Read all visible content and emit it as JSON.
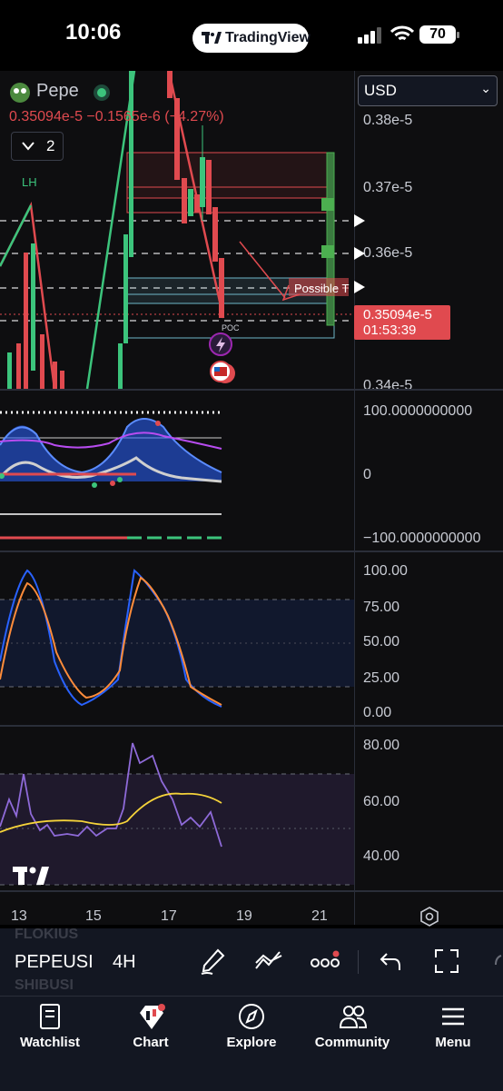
{
  "status_bar": {
    "time": "10:06",
    "app_pill": "TradingView",
    "battery": "70"
  },
  "symbol": {
    "name": "Pepe",
    "price_line": "0.35094e-5",
    "change_line": "−0.1565e-6 (−4.27%)",
    "collapse_count": "2",
    "currency": "USD",
    "last_price": "0.35094e-5",
    "countdown": "01:53:39"
  },
  "annotations": {
    "lh": "LH",
    "poc": "POC",
    "possible": "Possible T"
  },
  "price_axis": [
    "0.38e-5",
    "0.37e-5",
    "0.36e-5",
    "0.34e-5"
  ],
  "osc1_axis": [
    "100.0000000000",
    "0",
    "−100.0000000000"
  ],
  "stoch_axis": [
    "100.00",
    "75.00",
    "50.00",
    "25.00",
    "0.00"
  ],
  "rsi_axis": [
    "80.00",
    "60.00",
    "40.00"
  ],
  "time_axis": [
    "13",
    "15",
    "17",
    "19",
    "21"
  ],
  "bottom_bar": {
    "ticker": "PEPEUSI",
    "interval": "4H",
    "ghost_top": "FLOKIUS",
    "ghost_bottom": "SHIBUSI"
  },
  "tabs": [
    {
      "label": "Watchlist",
      "icon": "book-icon"
    },
    {
      "label": "Chart",
      "icon": "chart-icon"
    },
    {
      "label": "Explore",
      "icon": "compass-icon"
    },
    {
      "label": "Community",
      "icon": "community-icon"
    },
    {
      "label": "Menu",
      "icon": "menu-icon"
    }
  ],
  "colors": {
    "down": "#e04a4f",
    "up": "#3cc47c",
    "accent": "#2962ff",
    "background": "#0e0e10"
  }
}
